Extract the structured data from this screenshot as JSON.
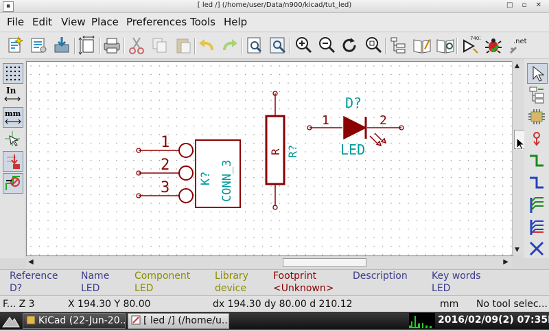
{
  "window": {
    "title": "[ led /] (/home/user/Data/n900/kicad/tut_led)",
    "controls": "□ ▫ ✕"
  },
  "menu": [
    {
      "label": "File"
    },
    {
      "label": "Edit"
    },
    {
      "label": "View"
    },
    {
      "label": "Place"
    },
    {
      "label": "Preferences"
    },
    {
      "label": "Tools"
    },
    {
      "label": "Help"
    }
  ],
  "toolbar": {
    "footprint_label": ".net",
    "eeschema_label": "7402"
  },
  "left_toolbar": {
    "inch_label": "In",
    "mm_label": "mm"
  },
  "schematic": {
    "connector": {
      "pins": [
        "1",
        "2",
        "3"
      ],
      "ref": "K?",
      "value": "CONN_3"
    },
    "resistor": {
      "name": "R",
      "ref": "R?"
    },
    "led": {
      "ref": "D?",
      "value": "LED",
      "pin1": "1",
      "pin2": "2"
    }
  },
  "message_panel": [
    {
      "title": "Reference",
      "value": "D?",
      "color": "#3c3c8c"
    },
    {
      "title": "Name",
      "value": "LED",
      "color": "#3c3c8c"
    },
    {
      "title": "Component",
      "value": "LED",
      "color": "#8c8c00"
    },
    {
      "title": "Library",
      "value": "device",
      "color": "#8c8c00"
    },
    {
      "title": "Footprint",
      "value": "<Unknown>",
      "color": "#8c0000"
    },
    {
      "title": "Description",
      "value": "",
      "color": "#3c3c8c"
    },
    {
      "title": "Key words",
      "value": "LED",
      "color": "#3c3c8c"
    }
  ],
  "status": {
    "zoom": "F... Z 3",
    "xy": "X 194.30  Y 80.00",
    "delta": "dx 194.30  dy 80.00  d 210.12",
    "units": "mm",
    "tool": "No tool selec..."
  },
  "taskbar": {
    "tasks": [
      {
        "label": "KiCad (22-Jun-20...",
        "active": false
      },
      {
        "label": "[ led /] (/home/u...",
        "active": true
      }
    ],
    "clock": "2016/02/09(2) 07:35PM"
  },
  "colors": {
    "wire": "#8b0000",
    "text_cyan": "#009a9a",
    "text_red": "#8b0000"
  }
}
